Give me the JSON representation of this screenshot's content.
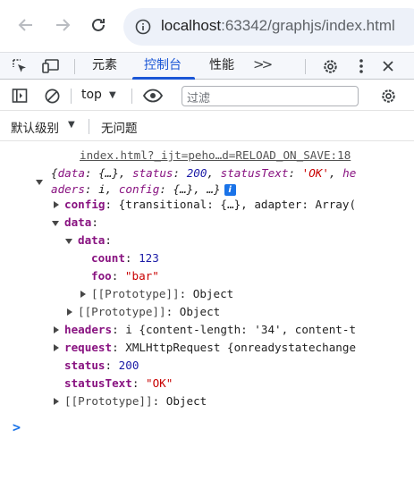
{
  "browser": {
    "url_host": "localhost",
    "url_rest": ":63342/graphjs/index.html"
  },
  "devtools": {
    "tabs": [
      "元素",
      "控制台",
      "性能"
    ],
    "active_tab": "控制台",
    "more_label": ">>"
  },
  "console_toolbar": {
    "context": "top",
    "filter_placeholder": "过滤",
    "levels_label": "默认级别",
    "issues_label": "无问题"
  },
  "console": {
    "source_link": "index.html?_ijt=peho…d=RELOAD_ON_SAVE:18",
    "summary_line1": "{data: {…}, status: 200, statusText: 'OK', he",
    "summary_line2": "aders: i, config: {…}, …}",
    "info_badge": "i",
    "rows": [
      {
        "key": "config",
        "rest": "{transitional: {…}, adapter: Array("
      },
      {
        "key": "data",
        "rest": ""
      },
      {
        "key": "data",
        "rest": ""
      },
      {
        "key": "count",
        "value": "123"
      },
      {
        "key": "foo",
        "value": "\"bar\""
      },
      {
        "key": "[[Prototype]]",
        "rest": "Object"
      },
      {
        "key": "[[Prototype]]",
        "rest": "Object"
      },
      {
        "key": "headers",
        "rest": "i {content-length: '34', content-t"
      },
      {
        "key": "request",
        "rest": "XMLHttpRequest {onreadystatechange"
      },
      {
        "key": "status",
        "value": "200"
      },
      {
        "key": "statusText",
        "value": "\"OK\""
      },
      {
        "key": "[[Prototype]]",
        "rest": "Object"
      }
    ],
    "prompt_symbol": ">"
  },
  "colors": {
    "accent": "#1a56d6",
    "key_purple": "#881280",
    "number_blue": "#1a1aa6",
    "string_red": "#c80000"
  }
}
